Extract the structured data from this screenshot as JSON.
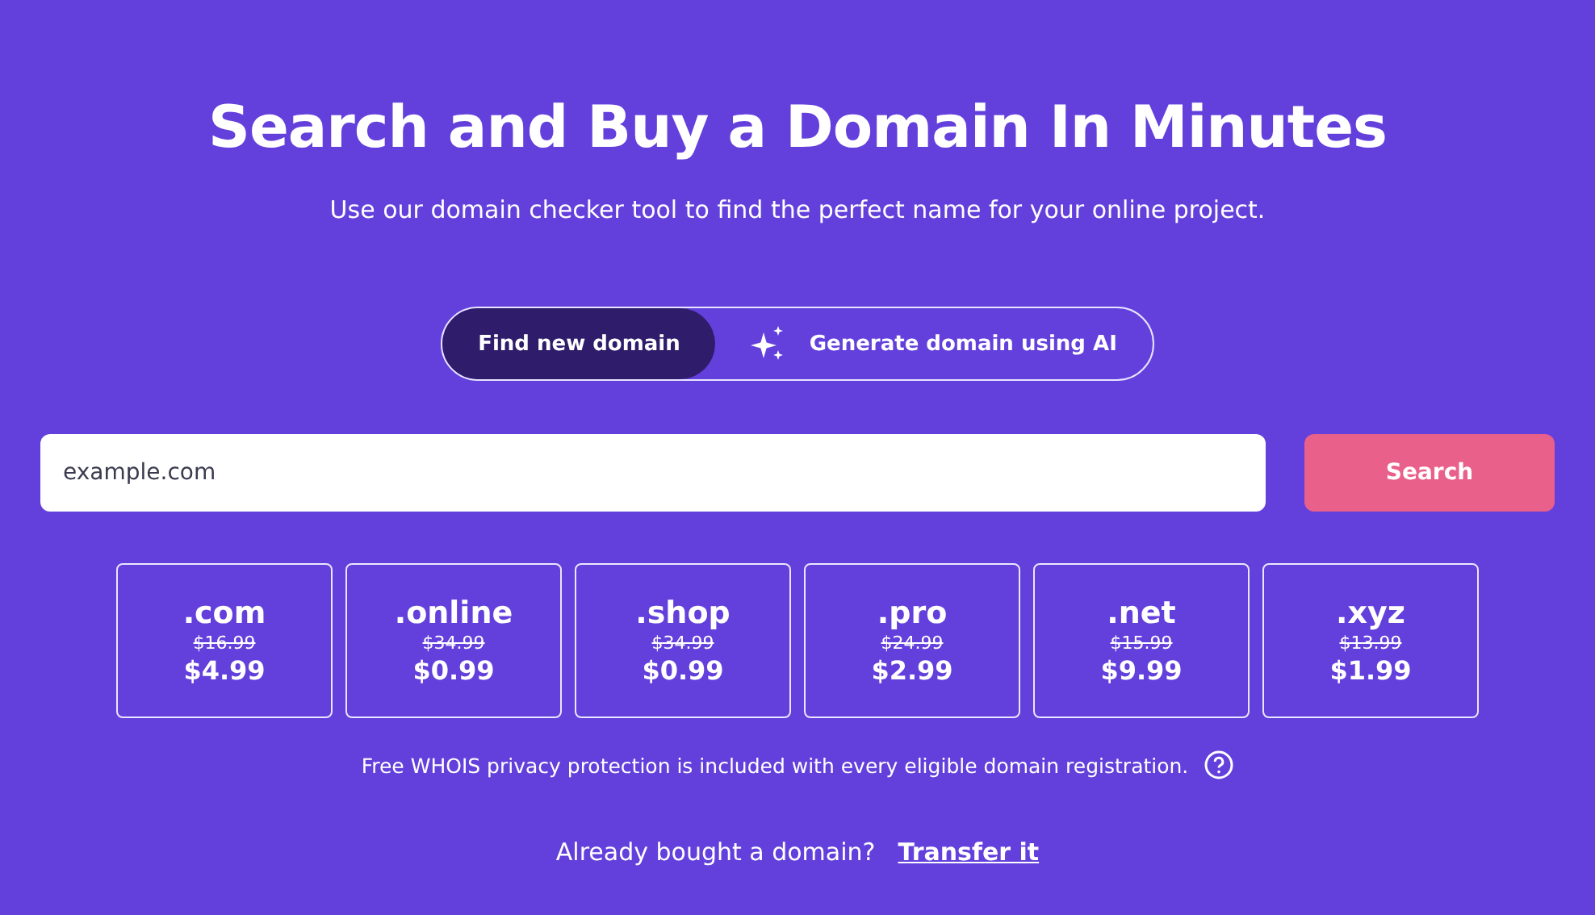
{
  "heading": "Search and Buy a Domain In Minutes",
  "subheading": "Use our domain checker tool to find the perfect name for your online project.",
  "modes": [
    {
      "label": "Find new domain",
      "selected": true,
      "kind": "plain"
    },
    {
      "label": "Generate domain using AI",
      "selected": false,
      "kind": "ai"
    }
  ],
  "search": {
    "placeholder": "example.com",
    "button": "Search"
  },
  "tlds": [
    {
      "name": ".com",
      "old_price": "$16.99",
      "price": "$4.99"
    },
    {
      "name": ".online",
      "old_price": "$34.99",
      "price": "$0.99"
    },
    {
      "name": ".shop",
      "old_price": "$34.99",
      "price": "$0.99"
    },
    {
      "name": ".pro",
      "old_price": "$24.99",
      "price": "$2.99"
    },
    {
      "name": ".net",
      "old_price": "$15.99",
      "price": "$9.99"
    },
    {
      "name": ".xyz",
      "old_price": "$13.99",
      "price": "$1.99"
    }
  ],
  "privacy_note": "Free WHOIS privacy protection is included with every eligible domain registration.",
  "transfer": {
    "question": "Already bought a domain?",
    "link": "Transfer it"
  }
}
